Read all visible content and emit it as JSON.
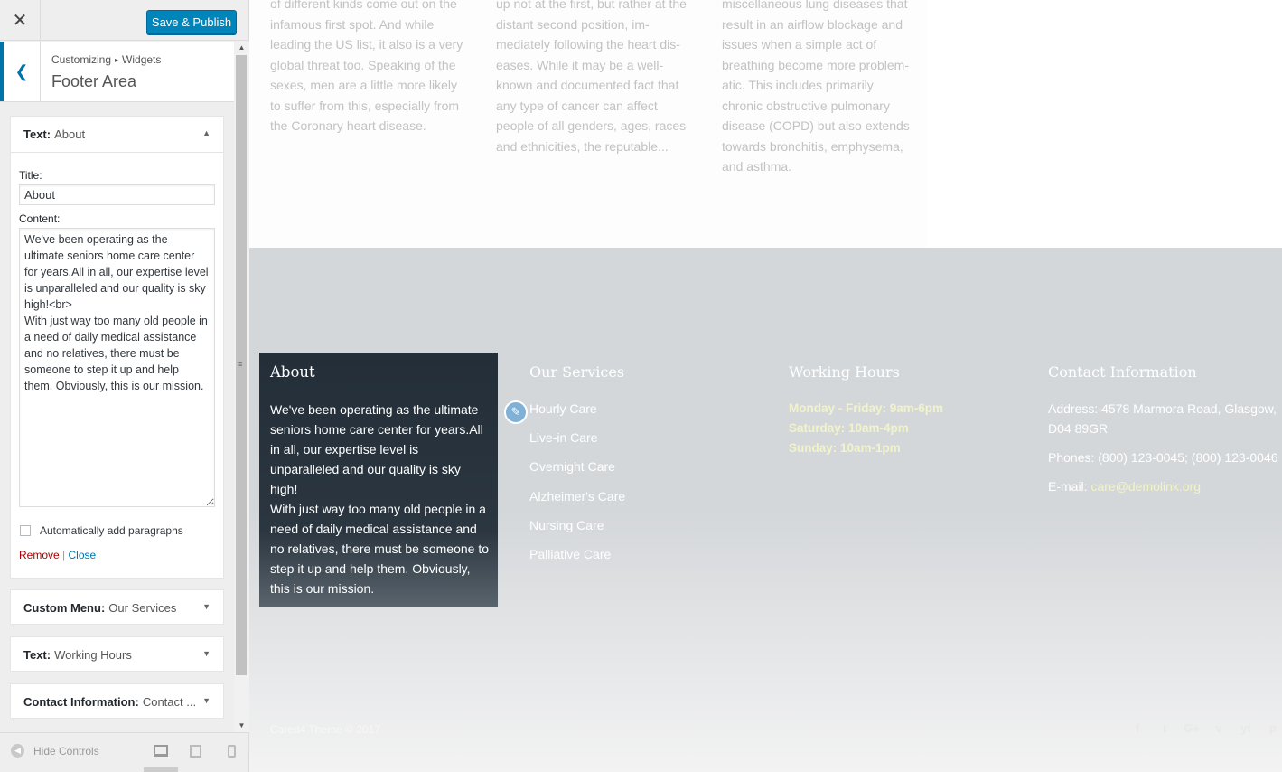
{
  "topbar": {
    "close_label": "✕",
    "publish_label": "Save & Publish"
  },
  "panel": {
    "breadcrumb_root": "Customizing",
    "breadcrumb_sep": "▸",
    "breadcrumb_leaf": "Widgets",
    "title": "Footer Area"
  },
  "widgets": {
    "about": {
      "type": "Text:",
      "name": "About",
      "title_label": "Title:",
      "title_value": "About",
      "content_label": "Content:",
      "content_value": "We've been operating as the ultimate seniors home care center for years.All in all, our expertise level is unparalleled and our quality is sky high!<br>\nWith just way too many old people in a need of daily medical assistance and no relatives, there must be someone to step it up and help them. Obviously, this is our mission.",
      "autop_label": "Automatically add paragraphs",
      "remove_label": "Remove",
      "sep": "|",
      "close_label": "Close"
    },
    "menu": {
      "type": "Custom Menu:",
      "name": "Our Services"
    },
    "hours": {
      "type": "Text:",
      "name": "Working Hours"
    },
    "contact": {
      "type": "Contact Information:",
      "name": "Contact ..."
    }
  },
  "controls": {
    "hide_label": "Hide Controls"
  },
  "preview": {
    "articles": [
      "of different kinds come out on the infamous first spot. And while leading the US list, it also is a very global threat too. Speaking of the sexes, men are a little more likely to suffer from this, especially from the Coronary heart disease.",
      "up not at the first, but rather at the distant second position, im-mediately following the heart dis-eases. While it may be a well-known and documented fact that any type of cancer can affect people of all genders, ages, races and ethnicities, the reputable...",
      "miscellaneous lung diseases that result in an airflow blockage and issues when a simple act of breathing become more problem-atic. This includes primarily chronic obstructive pulmonary disease (COPD) but also extends towards bronchitis, emphysema, and asthma."
    ],
    "about": {
      "title": "About",
      "text": "We've been operating as the ultimate seniors home care center for years.All in all, our expertise level is unparalleled and our quality is sky high!\nWith just way too many old people in a need of daily medical assistance and no relatives, there must be someone to step it up and help them. Obviously, this is our mission."
    },
    "services": {
      "title": "Our Services",
      "items": [
        "Hourly Care",
        "Live-in Care",
        "Overnight Care",
        "Alzheimer's Care",
        "Nursing Care",
        "Palliative Care"
      ]
    },
    "hours": {
      "title": "Working Hours",
      "lines": [
        "Monday - Friday: 9am-6pm",
        "Saturday: 10am-4pm",
        "Sunday: 10am-1pm"
      ]
    },
    "contact": {
      "title": "Contact Information",
      "address": "Address: 4578 Marmora Road, Glasgow, D04 89GR",
      "phones": "Phones: (800) 123-0045; (800) 123-0046",
      "email_label": "E-mail: ",
      "email": "care@demolink.org"
    },
    "copyright": "Cared4 Theme © 2017",
    "socials": [
      "f",
      "t",
      "G+",
      "v",
      "yt",
      "p"
    ]
  },
  "colors": {
    "accent": "#0085ba",
    "footer_bg": "#d4d7da",
    "about_bg": "#232e38",
    "highlight_text": "#f1f3c8"
  }
}
